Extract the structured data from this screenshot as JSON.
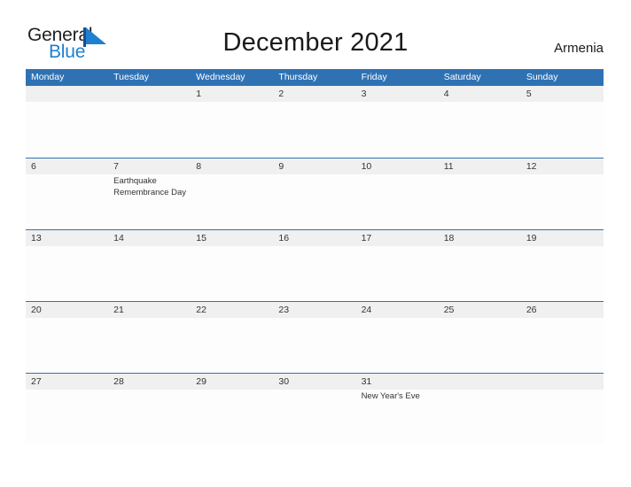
{
  "brand": {
    "name_part1": "General",
    "name_part2": "Blue",
    "flag_icon": "blue-flag-triangle-icon",
    "accent_color": "#1f7fd0"
  },
  "header": {
    "title": "December 2021",
    "country": "Armenia"
  },
  "theme": {
    "header_blue": "#2f72b4",
    "band_gray": "#f0f0f0",
    "text_dark": "#333333",
    "page_background": "#ffffff"
  },
  "calendar": {
    "weekdays": [
      "Monday",
      "Tuesday",
      "Wednesday",
      "Thursday",
      "Friday",
      "Saturday",
      "Sunday"
    ],
    "weeks": [
      {
        "days": [
          {
            "date": "",
            "events": []
          },
          {
            "date": "",
            "events": []
          },
          {
            "date": "1",
            "events": []
          },
          {
            "date": "2",
            "events": []
          },
          {
            "date": "3",
            "events": []
          },
          {
            "date": "4",
            "events": []
          },
          {
            "date": "5",
            "events": []
          }
        ]
      },
      {
        "days": [
          {
            "date": "6",
            "events": []
          },
          {
            "date": "7",
            "events": [
              "Earthquake Remembrance Day"
            ]
          },
          {
            "date": "8",
            "events": []
          },
          {
            "date": "9",
            "events": []
          },
          {
            "date": "10",
            "events": []
          },
          {
            "date": "11",
            "events": []
          },
          {
            "date": "12",
            "events": []
          }
        ]
      },
      {
        "days": [
          {
            "date": "13",
            "events": []
          },
          {
            "date": "14",
            "events": []
          },
          {
            "date": "15",
            "events": []
          },
          {
            "date": "16",
            "events": []
          },
          {
            "date": "17",
            "events": []
          },
          {
            "date": "18",
            "events": []
          },
          {
            "date": "19",
            "events": []
          }
        ]
      },
      {
        "days": [
          {
            "date": "20",
            "events": []
          },
          {
            "date": "21",
            "events": []
          },
          {
            "date": "22",
            "events": []
          },
          {
            "date": "23",
            "events": []
          },
          {
            "date": "24",
            "events": []
          },
          {
            "date": "25",
            "events": []
          },
          {
            "date": "26",
            "events": []
          }
        ]
      },
      {
        "days": [
          {
            "date": "27",
            "events": []
          },
          {
            "date": "28",
            "events": []
          },
          {
            "date": "29",
            "events": []
          },
          {
            "date": "30",
            "events": []
          },
          {
            "date": "31",
            "events": [
              "New Year's Eve"
            ]
          },
          {
            "date": "",
            "events": []
          },
          {
            "date": "",
            "events": []
          }
        ]
      }
    ]
  }
}
